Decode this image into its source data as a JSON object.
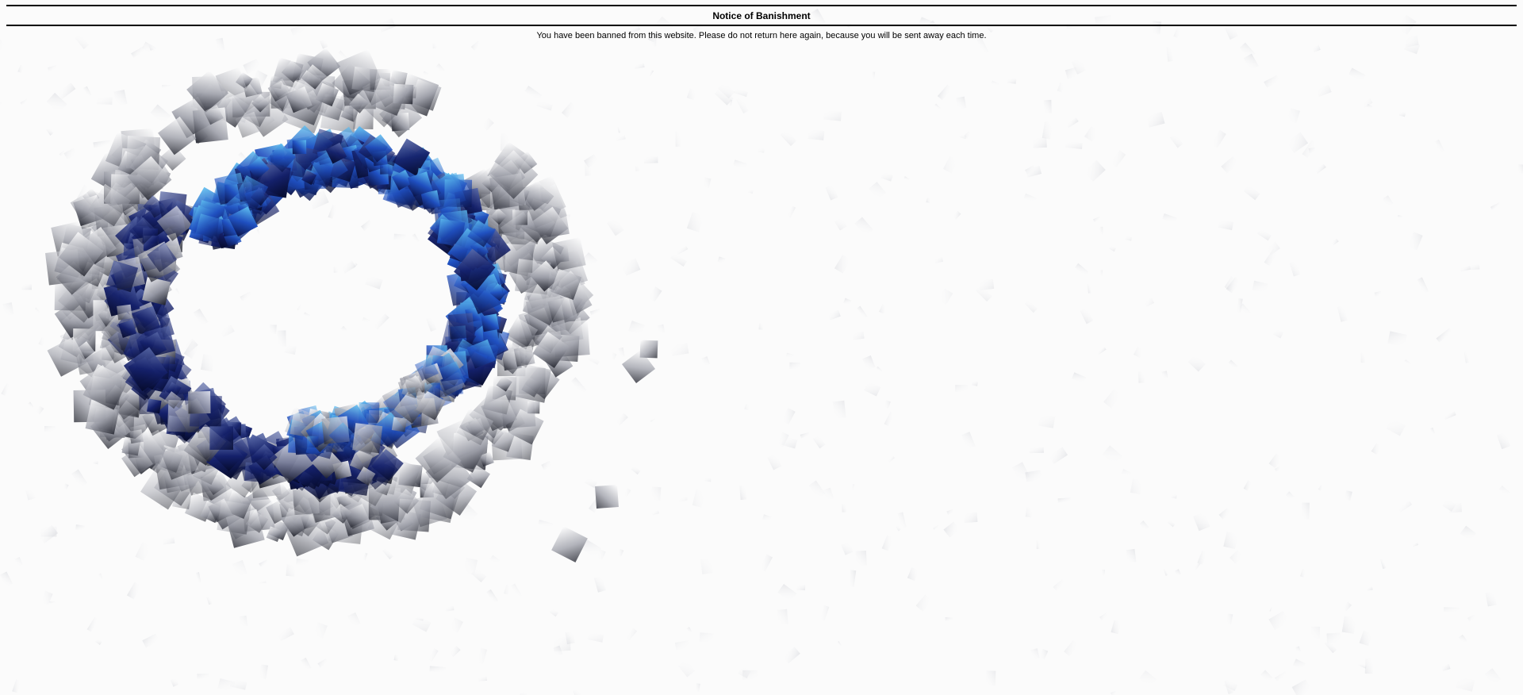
{
  "notice": {
    "title": "Notice of Banishment",
    "message": "You have been banned from this website. Please do not return here again, because you will be sent away each time."
  },
  "background": {
    "artwork": "swirl-of-scattered-blue-and-grey-squares",
    "colors": {
      "deep_navy": "#0a1247",
      "royal_blue": "#1f3fb0",
      "sky_blue": "#3aa0e6",
      "charcoal": "#2a2c38",
      "light_grey": "#d7d8dc"
    }
  }
}
